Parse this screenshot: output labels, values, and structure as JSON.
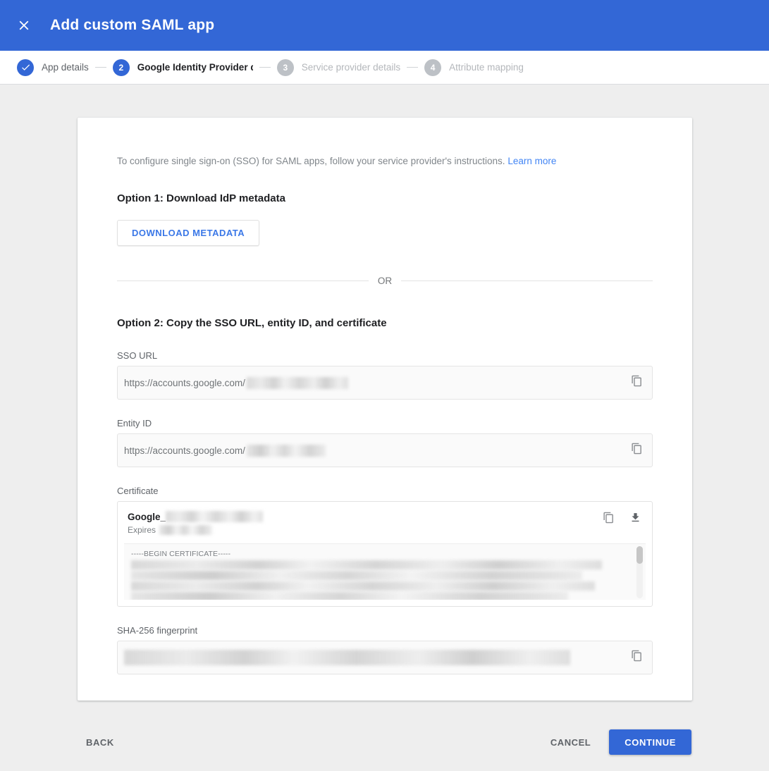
{
  "appbar": {
    "title": "Add custom SAML app",
    "close_icon": "close-icon",
    "background_color": "#3367d6"
  },
  "stepper": {
    "steps": [
      {
        "number": "1",
        "label": "App details",
        "state": "done",
        "icon": "check-icon"
      },
      {
        "number": "2",
        "label": "Google Identity Provider details",
        "state": "active"
      },
      {
        "number": "3",
        "label": "Service provider details",
        "state": "todo"
      },
      {
        "number": "4",
        "label": "Attribute mapping",
        "state": "todo"
      }
    ]
  },
  "card": {
    "intro": {
      "text": "To configure single sign-on (SSO) for SAML apps, follow your service provider's instructions.",
      "link_label": "Learn more",
      "link_color": "#4285f4"
    },
    "option1": {
      "heading": "Option 1: Download IdP metadata",
      "download_button_label": "DOWNLOAD METADATA"
    },
    "divider_label": "OR",
    "option2": {
      "heading": "Option 2: Copy the SSO URL, entity ID, and certificate",
      "fields": [
        {
          "label": "SSO URL",
          "value_prefix": "https://accounts.google.com/",
          "value_redacted": true,
          "copy_icon": "copy-icon"
        },
        {
          "label": "Entity ID",
          "value_prefix": "https://accounts.google.com/",
          "value_redacted": true,
          "copy_icon": "copy-icon"
        }
      ],
      "certificate": {
        "label": "Certificate",
        "name_prefix": "Google_",
        "name_redacted": true,
        "expires_label": "Expires",
        "expires_redacted": true,
        "copy_icon": "copy-icon",
        "download_icon": "download-icon",
        "body_begin_line": "-----BEGIN CERTIFICATE-----",
        "body_redacted": true
      },
      "fingerprint": {
        "label": "SHA-256 fingerprint",
        "value_redacted": true,
        "copy_icon": "copy-icon"
      }
    }
  },
  "footer": {
    "back_label": "BACK",
    "cancel_label": "CANCEL",
    "continue_label": "CONTINUE",
    "continue_color": "#3367d6"
  }
}
